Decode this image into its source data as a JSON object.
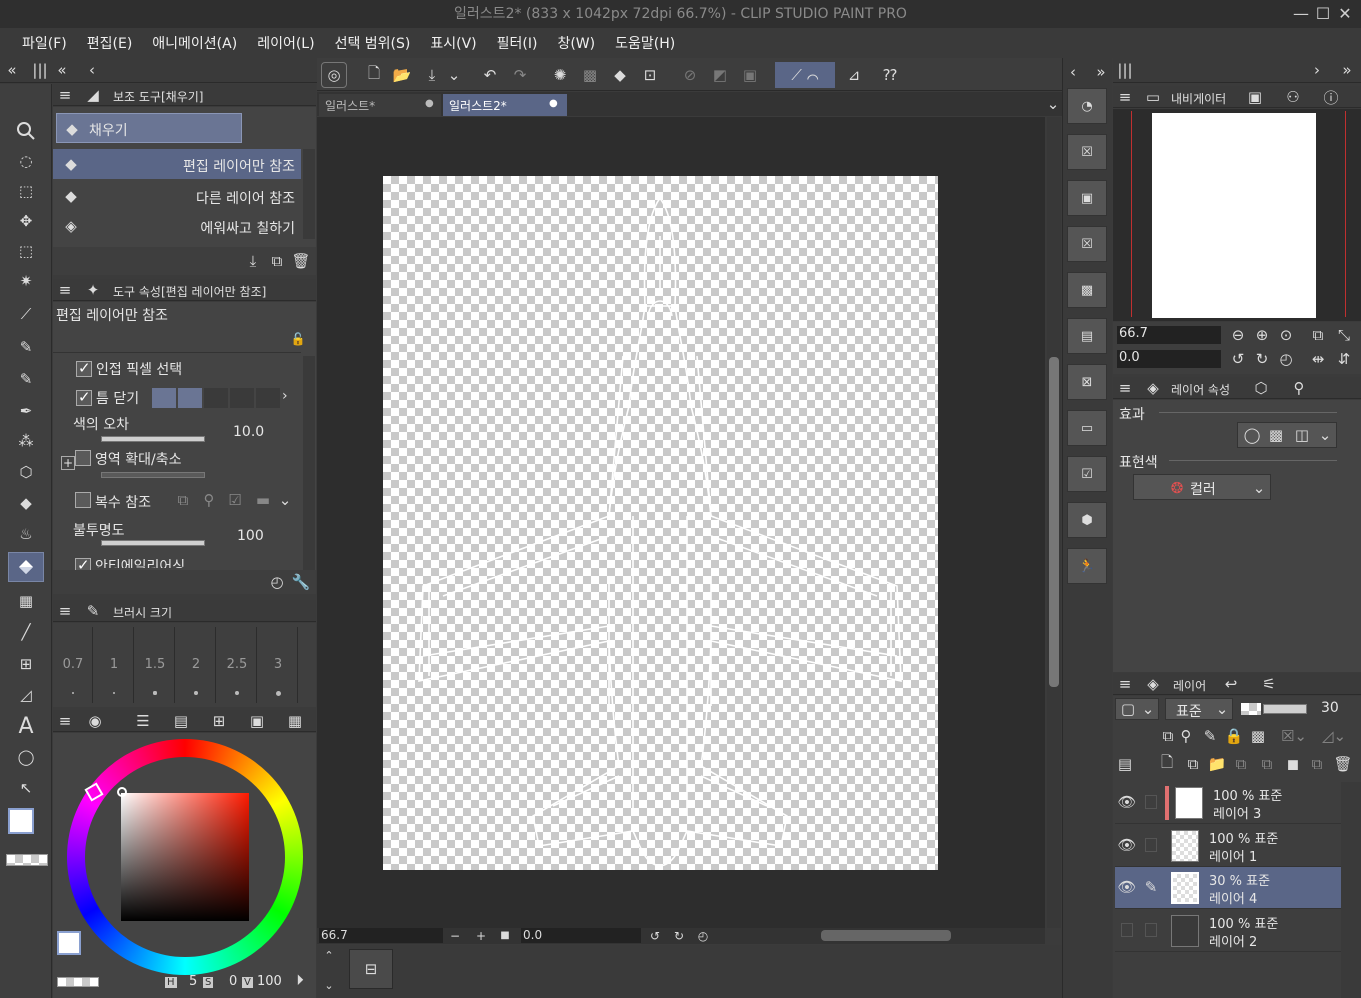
{
  "window": {
    "title": "일러스트2* (833 x 1042px 72dpi 66.7%)  - CLIP STUDIO PAINT PRO",
    "min": "—",
    "max": "☐",
    "close": "✕"
  },
  "menu": [
    "파일(F)",
    "편집(E)",
    "애니메이션(A)",
    "레이어(L)",
    "선택 범위(S)",
    "표시(V)",
    "필터(I)",
    "창(W)",
    "도움말(H)"
  ],
  "subtool": {
    "header": "보조 도구[채우기]",
    "group": "채우기",
    "items": [
      "편집 레이어만 참조",
      "다른 레이어 참조",
      "에워싸고 칠하기"
    ]
  },
  "toolprop": {
    "header": "도구 속성[편집 레이어만 참조]",
    "name": "편집 레이어만 참조",
    "adjacent": "인접 픽셀 선택",
    "gap": "틈 닫기",
    "tolerance_label": "색의 오차",
    "tolerance_value": "10.0",
    "expand_label": "영역 확대/축소",
    "multi": "복수 참조",
    "opacity_label": "불투명도",
    "opacity_value": "100",
    "antialias": "안티에일리어싱"
  },
  "brushsize": {
    "header": "브러시 크기",
    "sizes": [
      "0.7",
      "1",
      "1.5",
      "2",
      "2.5",
      "3"
    ]
  },
  "color": {
    "h": "5",
    "s": "0",
    "v": "100",
    "h_lbl": "H",
    "s_lbl": "S",
    "v_lbl": "V"
  },
  "tabs": [
    {
      "label": "일러스트*",
      "close": "●"
    },
    {
      "label": "일러스트2*",
      "close": "●"
    }
  ],
  "canvas": {
    "zoom": "66.7",
    "angle": "0.0"
  },
  "navigator": {
    "header": "내비게이터",
    "zoom": "66.7",
    "angle": "0.0"
  },
  "layerprop": {
    "header": "레이어 속성",
    "effect": "효과",
    "expression": "표현색",
    "expression_value": "컬러"
  },
  "layers": {
    "header": "레이어",
    "blend": "표준",
    "opacity": "30",
    "items": [
      {
        "pct": "100 % 표준",
        "name": "레이어 3"
      },
      {
        "pct": "100 % 표준",
        "name": "레이어 1"
      },
      {
        "pct": "30 % 표준",
        "name": "레이어 4"
      },
      {
        "pct": "100 % 표준",
        "name": "레이어 2"
      }
    ]
  }
}
